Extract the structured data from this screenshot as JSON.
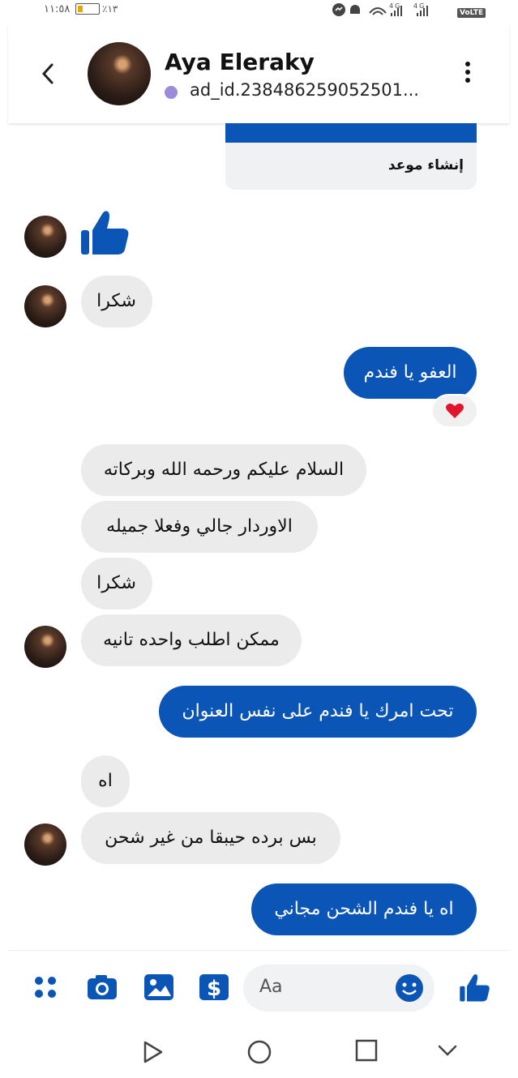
{
  "status_bar": {
    "time": "١١:٥٨",
    "battery_percent_text": "٪١٣",
    "network_right": "4G 4G",
    "volte": "VoLTE"
  },
  "header": {
    "name": "Aya Eleraky",
    "subtitle": "ad_id.238486259052501..."
  },
  "ad_card": {
    "label": "إنشاء موعد"
  },
  "messages": [
    {
      "side": "in",
      "type": "like"
    },
    {
      "side": "in",
      "text": "شكرا"
    },
    {
      "side": "out",
      "text": "العفو يا فندم",
      "reaction": "heart"
    },
    {
      "side": "in",
      "text": "السلام عليكم ورحمه الله وبركاته"
    },
    {
      "side": "in",
      "text": "الاوردار جالي وفعلا جميله"
    },
    {
      "side": "in",
      "text": "شكرا"
    },
    {
      "side": "in",
      "text": "ممكن اطلب واحده تانيه"
    },
    {
      "side": "out",
      "text": "تحت امرك يا فندم على نفس العنوان"
    },
    {
      "side": "in",
      "text": "اه"
    },
    {
      "side": "in",
      "text": "بس برده حيبقا من غير شحن"
    },
    {
      "side": "out",
      "text": "اه يا فندم الشحن مجاني"
    }
  ],
  "composer": {
    "placeholder": "Aa",
    "icons": [
      "grid-icon",
      "camera-icon",
      "gallery-icon",
      "payment-icon",
      "emoji-icon",
      "thumbs-up-icon"
    ]
  },
  "colors": {
    "accent": "#0b55b6",
    "incoming_bubble": "#ebebeb",
    "heart": "#e0152b"
  },
  "nav": {
    "icons": [
      "back-triangle-icon",
      "home-circle-icon",
      "recents-square-icon",
      "hide-chevron-icon"
    ]
  }
}
